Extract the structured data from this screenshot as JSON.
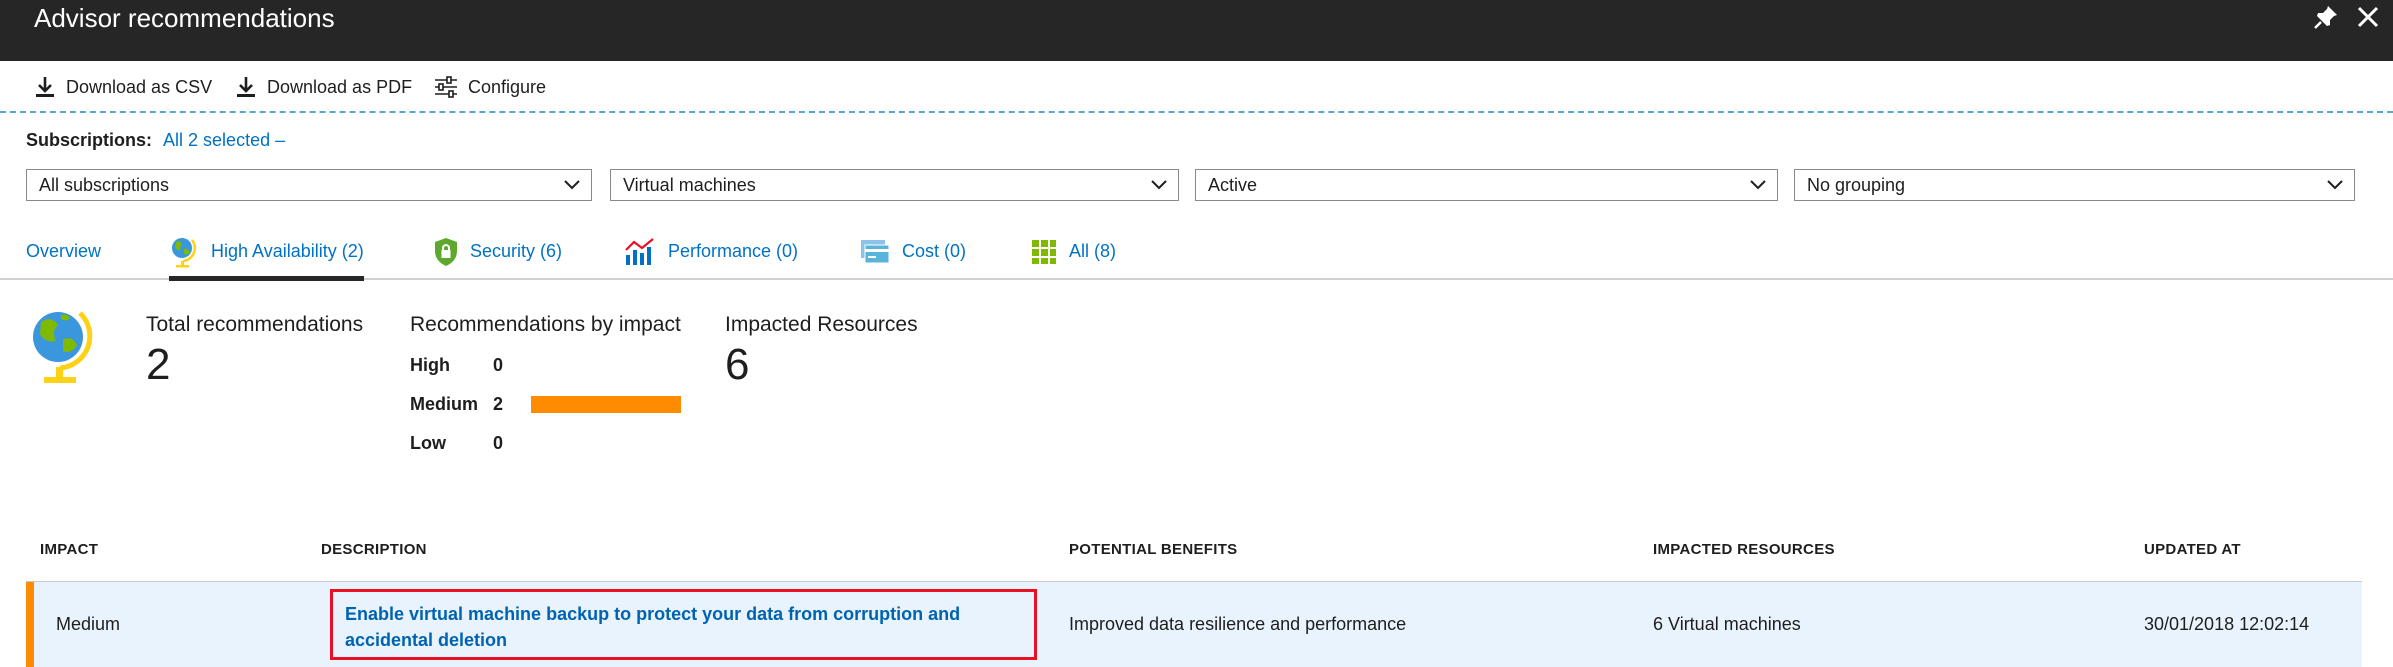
{
  "window": {
    "title": "Advisor recommendations",
    "pin_icon": "pin-icon",
    "close_icon": "close-icon"
  },
  "toolbar": {
    "download_csv": "Download as CSV",
    "download_pdf": "Download as PDF",
    "configure": "Configure"
  },
  "subscriptions": {
    "label": "Subscriptions:",
    "value": "All 2 selected –"
  },
  "filters": {
    "subscription": "All subscriptions",
    "resource_type": "Virtual machines",
    "status": "Active",
    "grouping": "No grouping"
  },
  "tabs": [
    {
      "label": "Overview",
      "icon": ""
    },
    {
      "label": "High Availability (2)",
      "icon": "globe-icon",
      "active": true
    },
    {
      "label": "Security (6)",
      "icon": "shield-lock-icon"
    },
    {
      "label": "Performance (0)",
      "icon": "performance-chart-icon"
    },
    {
      "label": "Cost (0)",
      "icon": "cost-card-icon"
    },
    {
      "label": "All (8)",
      "icon": "grid-icon"
    }
  ],
  "summary": {
    "total_label": "Total recommendations",
    "total_value": "2",
    "by_impact_label": "Recommendations by impact",
    "impacts": [
      {
        "level": "High",
        "count": "0"
      },
      {
        "level": "Medium",
        "count": "2"
      },
      {
        "level": "Low",
        "count": "0"
      }
    ],
    "impacted_label": "Impacted Resources",
    "impacted_value": "6"
  },
  "table": {
    "headers": [
      "IMPACT",
      "DESCRIPTION",
      "POTENTIAL BENEFITS",
      "IMPACTED RESOURCES",
      "UPDATED AT"
    ],
    "rows": [
      {
        "impact": "Medium",
        "description": "Enable virtual machine backup to protect your data from corruption and accidental deletion",
        "benefits": "Improved data resilience and performance",
        "resources": "6 Virtual machines",
        "updated": "30/01/2018 12:02:14"
      }
    ]
  },
  "colors": {
    "titlebar": "#262626",
    "link": "#0072c6",
    "medium_impact": "#ff8c00",
    "row_bg": "#e8f3fd",
    "highlight_border": "#e81123"
  }
}
